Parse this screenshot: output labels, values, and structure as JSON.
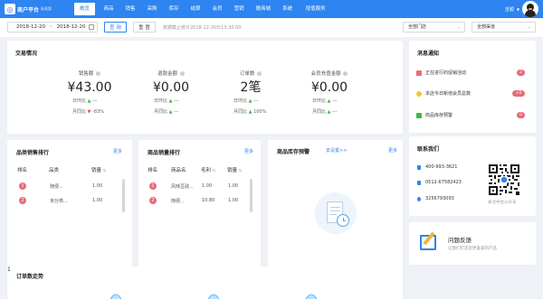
{
  "header": {
    "logo_name": "商户平台",
    "edition": "标准版",
    "nav": [
      "概览",
      "商品",
      "销售",
      "采购",
      "库存",
      "结算",
      "会员",
      "营销",
      "微商城",
      "系统",
      "增值服务"
    ],
    "user_name": "吉顺"
  },
  "filter": {
    "date_start": "2018-12-20",
    "date_sep": "~",
    "date_end": "2018-12-20",
    "query_label": "查 询",
    "reset_label": "重 置",
    "hint": "数据截止统计2018-12-20日13:30:00",
    "store_select": "全部门店",
    "channel_select": "全部渠道"
  },
  "trade": {
    "title": "交易情况",
    "day_label": "日环比",
    "month_label": "月同比",
    "stats": [
      {
        "label": "销售额",
        "value": "¥43.00",
        "day": "---",
        "month": "-83%"
      },
      {
        "label": "退款金额",
        "value": "¥0.00",
        "day": "---",
        "month": "---"
      },
      {
        "label": "订单数",
        "value": "2笔",
        "day": "---",
        "month": "100%"
      },
      {
        "label": "会员充值金额",
        "value": "¥0.00",
        "day": "---",
        "month": "---"
      }
    ]
  },
  "category_rank": {
    "title": "品类销售排行",
    "more": "更多",
    "headers": [
      "排名",
      "品类",
      "销量"
    ],
    "rows": [
      {
        "rank": "1",
        "name": "随便...",
        "qty": "1.00"
      },
      {
        "rank": "2",
        "name": "未分类...",
        "qty": "1.00"
      }
    ]
  },
  "product_rank": {
    "title": "商品销量排行",
    "more": "更多",
    "headers": [
      "排名",
      "商品名",
      "毛利",
      "销量"
    ],
    "rows": [
      {
        "rank": "1",
        "name": "风味豆豉...",
        "profit": "1.00",
        "qty": "1.00"
      },
      {
        "rank": "2",
        "name": "随便...",
        "profit": "10.80",
        "qty": "1.00"
      }
    ]
  },
  "stock_alert": {
    "title": "商品库存预警",
    "link": "去设置>>",
    "more": "更多"
  },
  "order_trend": {
    "title": "订单数走势",
    "axis_value": "1"
  },
  "notices": {
    "title": "消息通知",
    "items": [
      {
        "label": "正在进行的促销活动",
        "count": "2"
      },
      {
        "label": "本店今日新增会员总数",
        "count": "+0"
      },
      {
        "label": "商品库存预警",
        "count": "0"
      }
    ]
  },
  "contact": {
    "title": "联系我们",
    "phone": "400-993-3621",
    "tel": "0512-67582423",
    "qq": "3256793093",
    "qr_caption": "关注中台公众号"
  },
  "feedback": {
    "title": "问题反馈",
    "desc": "让我们打造您更喜爱的产品"
  },
  "colors": {
    "brand": "#2e84f0",
    "badge": "#e86b78",
    "up": "#3cb944",
    "down": "#e64646"
  }
}
